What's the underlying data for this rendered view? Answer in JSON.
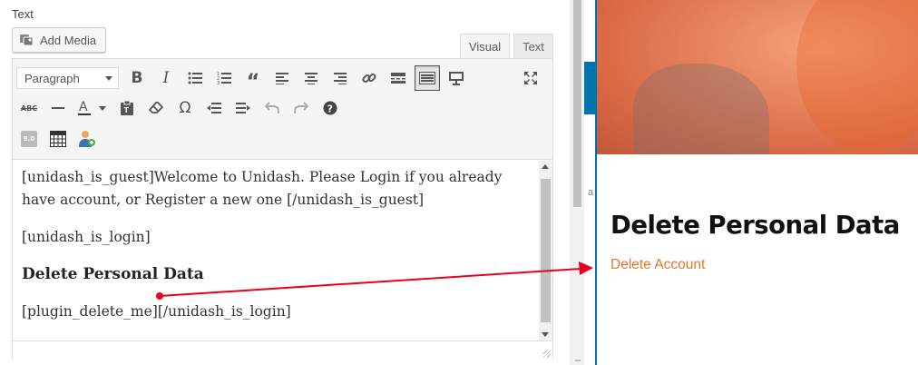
{
  "editor": {
    "section_label": "Text",
    "add_media_label": "Add Media",
    "tabs": {
      "visual": "Visual",
      "text": "Text"
    },
    "format_select_value": "Paragraph",
    "toolbar_row1": [
      "bold-icon",
      "italic-icon",
      "bulleted-list-icon",
      "numbered-list-icon",
      "blockquote-icon",
      "align-left-icon",
      "align-center-icon",
      "align-right-icon",
      "link-icon",
      "read-more-icon",
      "toolbar-toggle-icon",
      "preview-icon"
    ],
    "toolbar_row2": [
      "strikethrough-icon",
      "horizontal-rule-icon",
      "text-color-icon",
      "paste-as-text-icon",
      "clear-formatting-icon",
      "special-character-icon",
      "outdent-icon",
      "indent-icon",
      "undo-icon",
      "redo-icon",
      "help-icon"
    ],
    "toolbar_row3": [
      "version-badge-icon",
      "table-icon",
      "user-shortcode-icon"
    ],
    "version_badge": "9.0",
    "content": {
      "guest_paragraph": "[unidash_is_guest]Welcome to Unidash. Please Login if you already have account, or Register a new one [/unidash_is_guest]",
      "login_open": "[unidash_is_login]",
      "heading": "Delete Personal Data",
      "shortcode_line": "[plugin_delete_me][/unidash_is_login]"
    }
  },
  "preview": {
    "edge_letter": "a",
    "heading": "Delete Personal Data",
    "link_text": "Delete Account"
  },
  "colors": {
    "accent_orange": "#e8752c",
    "annotation_red": "#e8001c",
    "wp_blue": "#0073aa"
  }
}
